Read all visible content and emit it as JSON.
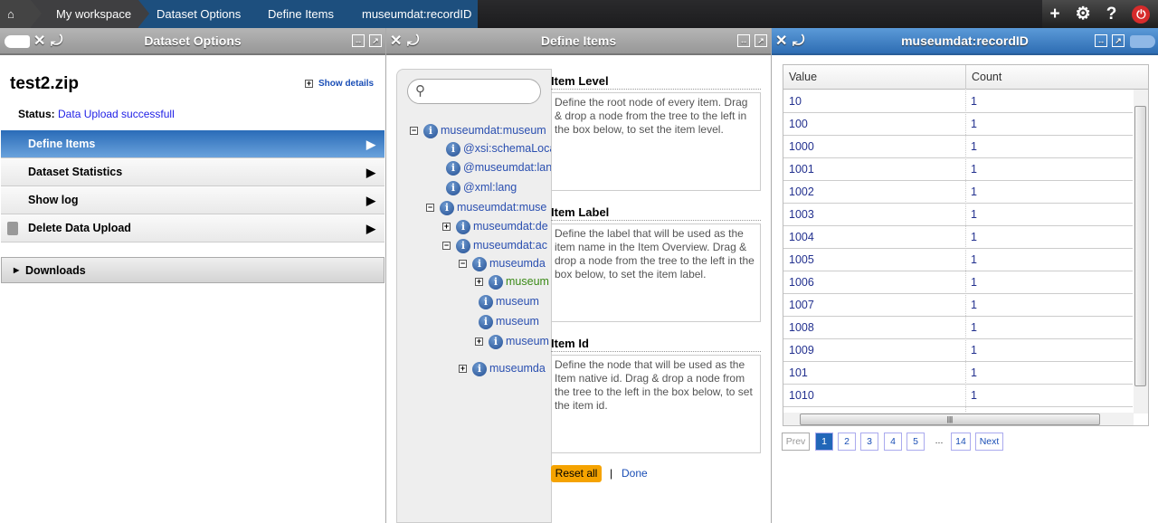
{
  "breadcrumb": {
    "items": [
      "My workspace",
      "Dataset Options",
      "Define Items",
      "museumdat:recordID"
    ]
  },
  "toolbar": {
    "icons": [
      "plus-icon",
      "gear-icon",
      "help-icon",
      "power-icon"
    ],
    "plus": "+",
    "help": "?"
  },
  "panels": {
    "left": {
      "title": "Dataset Options",
      "filename": "test2.zip",
      "show_details": "Show details",
      "status_label": "Status:",
      "status_value": "Data Upload successfull",
      "menu": [
        {
          "label": "Define Items",
          "selected": true
        },
        {
          "label": "Dataset Statistics"
        },
        {
          "label": "Show log"
        },
        {
          "label": "Delete Data Upload",
          "icon": "trash-icon"
        }
      ],
      "downloads": "Downloads"
    },
    "middle": {
      "title": "Define Items",
      "search_placeholder": "",
      "tree": [
        {
          "label": "museumdat:museum",
          "toggle": "-"
        },
        {
          "label": "@xsi:schemaLoca",
          "toggle": ""
        },
        {
          "label": "@museumdat:lan",
          "toggle": ""
        },
        {
          "label": "@xml:lang",
          "toggle": ""
        },
        {
          "label": "museumdat:muse",
          "toggle": "-"
        },
        {
          "label": "museumdat:de",
          "toggle": "+"
        },
        {
          "label": "museumdat:ac",
          "toggle": "-"
        },
        {
          "label": "museumda",
          "toggle": "-"
        },
        {
          "label": "museum",
          "toggle": "+",
          "highlight": true
        },
        {
          "label": "museum",
          "toggle": ""
        },
        {
          "label": "museum",
          "toggle": ""
        },
        {
          "label": "museum",
          "toggle": "+"
        },
        {
          "label": "museumda",
          "toggle": "+"
        }
      ],
      "sections": [
        {
          "title": "Item Level",
          "desc": "Define the root node of every item. Drag & drop a node from the tree to the left in the box below, to set the item level."
        },
        {
          "title": "Item Label",
          "desc": "Define the label that will be used as the item name in the Item Overview. Drag & drop a node from the tree to the left in the box below, to set the item label."
        },
        {
          "title": "Item Id",
          "desc": "Define the node that will be used as the Item native id. Drag & drop a node from the tree to the left in the box below, to set the item id."
        }
      ],
      "reset_label": "Reset all",
      "separator": "|",
      "done_label": "Done"
    },
    "right": {
      "title": "museumdat:recordID",
      "columns": [
        "Value",
        "Count"
      ],
      "rows": [
        [
          "10",
          "1"
        ],
        [
          "100",
          "1"
        ],
        [
          "1000",
          "1"
        ],
        [
          "1001",
          "1"
        ],
        [
          "1002",
          "1"
        ],
        [
          "1003",
          "1"
        ],
        [
          "1004",
          "1"
        ],
        [
          "1005",
          "1"
        ],
        [
          "1006",
          "1"
        ],
        [
          "1007",
          "1"
        ],
        [
          "1008",
          "1"
        ],
        [
          "1009",
          "1"
        ],
        [
          "101",
          "1"
        ],
        [
          "1010",
          "1"
        ]
      ],
      "pagination": {
        "prev": "Prev",
        "pages": [
          "1",
          "2",
          "3",
          "4",
          "5"
        ],
        "ellipsis": "...",
        "last": "14",
        "next": "Next",
        "current": "1"
      }
    }
  },
  "colors": {
    "accent": "#2e6db3",
    "reset": "#f5a300",
    "link": "#1a4eb6"
  }
}
